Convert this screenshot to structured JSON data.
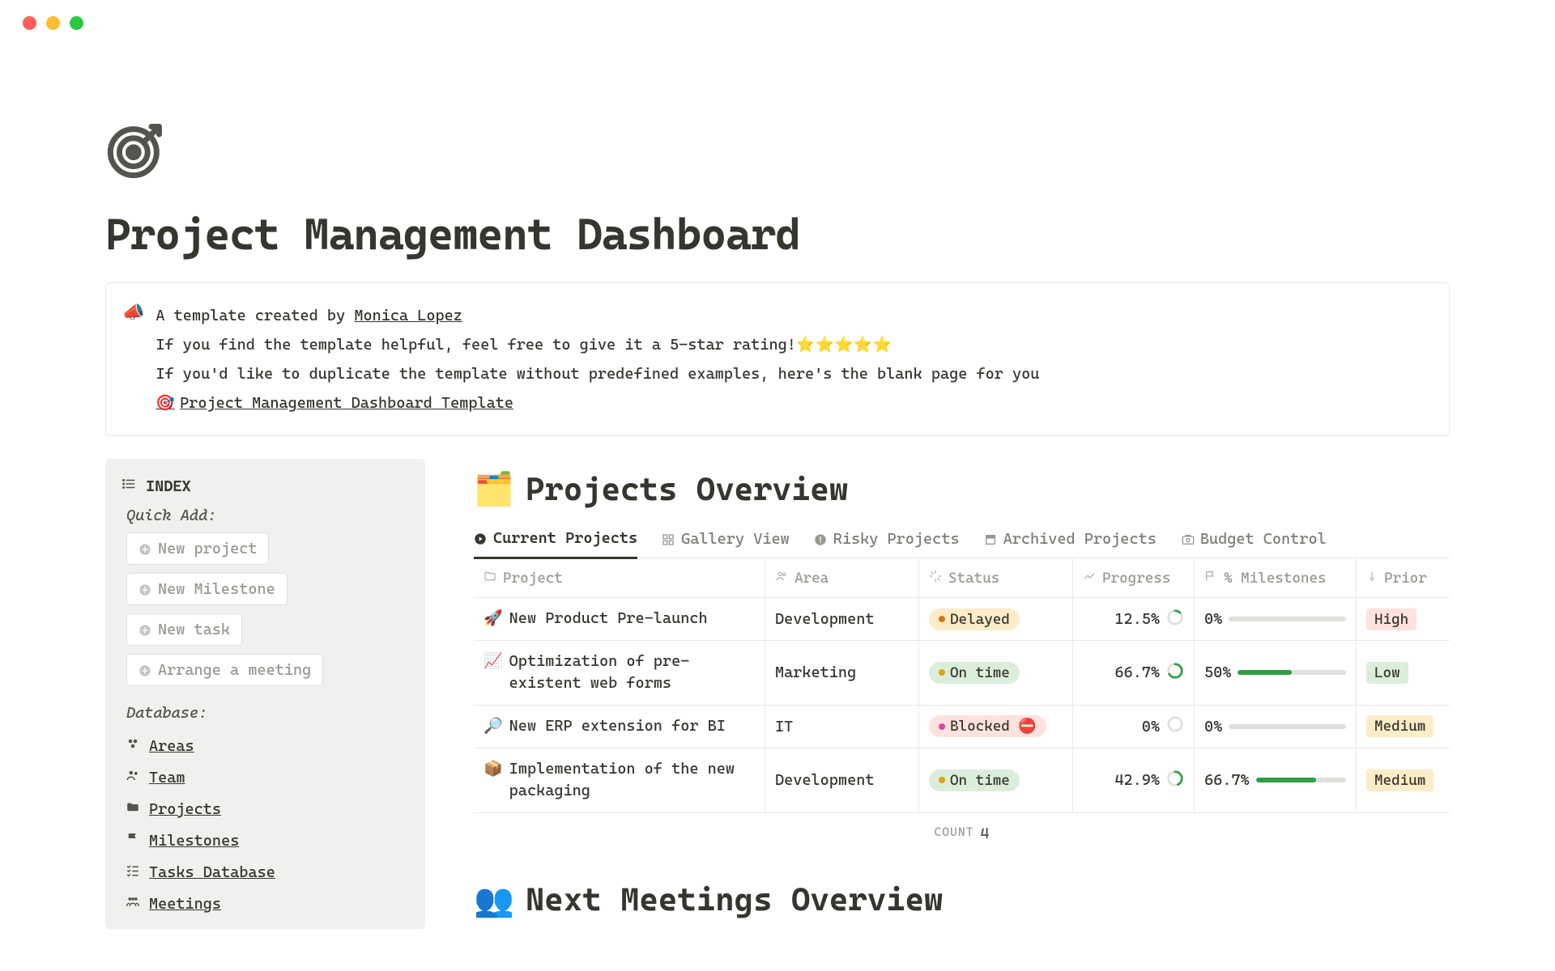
{
  "title": "Project Management Dashboard",
  "callout": {
    "line1_prefix": "A template created by ",
    "author": "Monica Lopez",
    "line2": "If you find the template helpful, feel free to give it a 5-star rating!⭐⭐⭐⭐⭐",
    "line3": "If you'd like to duplicate the template without predefined examples, here's the blank page for you",
    "template_link": "Project Management Dashboard Template"
  },
  "sidebar": {
    "index_label": "INDEX",
    "quick_add_label": "Quick Add:",
    "quick_add": [
      "New project",
      "New Milestone",
      "New task",
      "Arrange a meeting"
    ],
    "database_label": "Database:",
    "database": [
      {
        "icon": "areas",
        "label": "Areas"
      },
      {
        "icon": "team",
        "label": "Team"
      },
      {
        "icon": "projects",
        "label": "Projects"
      },
      {
        "icon": "milestones",
        "label": "Milestones"
      },
      {
        "icon": "tasks",
        "label": "Tasks Database"
      },
      {
        "icon": "meetings",
        "label": "Meetings"
      }
    ]
  },
  "projects": {
    "heading": "Projects Overview",
    "heading_emoji": "🗂️",
    "tabs": [
      "Current Projects",
      "Gallery View",
      "Risky Projects",
      "Archived Projects",
      "Budget Control"
    ],
    "columns": {
      "project": "Project",
      "area": "Area",
      "status": "Status",
      "progress": "Progress",
      "milestones": "% Milestones",
      "priority": "Prior"
    },
    "rows": [
      {
        "emoji": "🚀",
        "name": "New Product Pre-launch",
        "area": "Development",
        "status": "Delayed",
        "status_class": "delayed",
        "progress": "12.5%",
        "progress_val": 12.5,
        "milestones": "0%",
        "milestones_val": 0,
        "priority": "High",
        "priority_class": "high"
      },
      {
        "emoji": "📈",
        "name": "Optimization of pre-existent web forms",
        "area": "Marketing",
        "status": "On time",
        "status_class": "ontime",
        "progress": "66.7%",
        "progress_val": 66.7,
        "milestones": "50%",
        "milestones_val": 50,
        "priority": "Low",
        "priority_class": "low"
      },
      {
        "emoji": "🔎",
        "name": "New ERP extension for BI",
        "area": "IT",
        "status": "Blocked ⛔",
        "status_class": "blocked",
        "progress": "0%",
        "progress_val": 0,
        "milestones": "0%",
        "milestones_val": 0,
        "priority": "Medium",
        "priority_class": "medium"
      },
      {
        "emoji": "📦",
        "name": "Implementation of the new packaging",
        "area": "Development",
        "status": "On time",
        "status_class": "ontime",
        "progress": "42.9%",
        "progress_val": 42.9,
        "milestones": "66.7%",
        "milestones_val": 66.7,
        "priority": "Medium",
        "priority_class": "medium"
      }
    ],
    "count_label": "COUNT",
    "count": "4"
  },
  "meetings": {
    "heading_emoji": "👥",
    "heading": "Next Meetings Overview"
  }
}
